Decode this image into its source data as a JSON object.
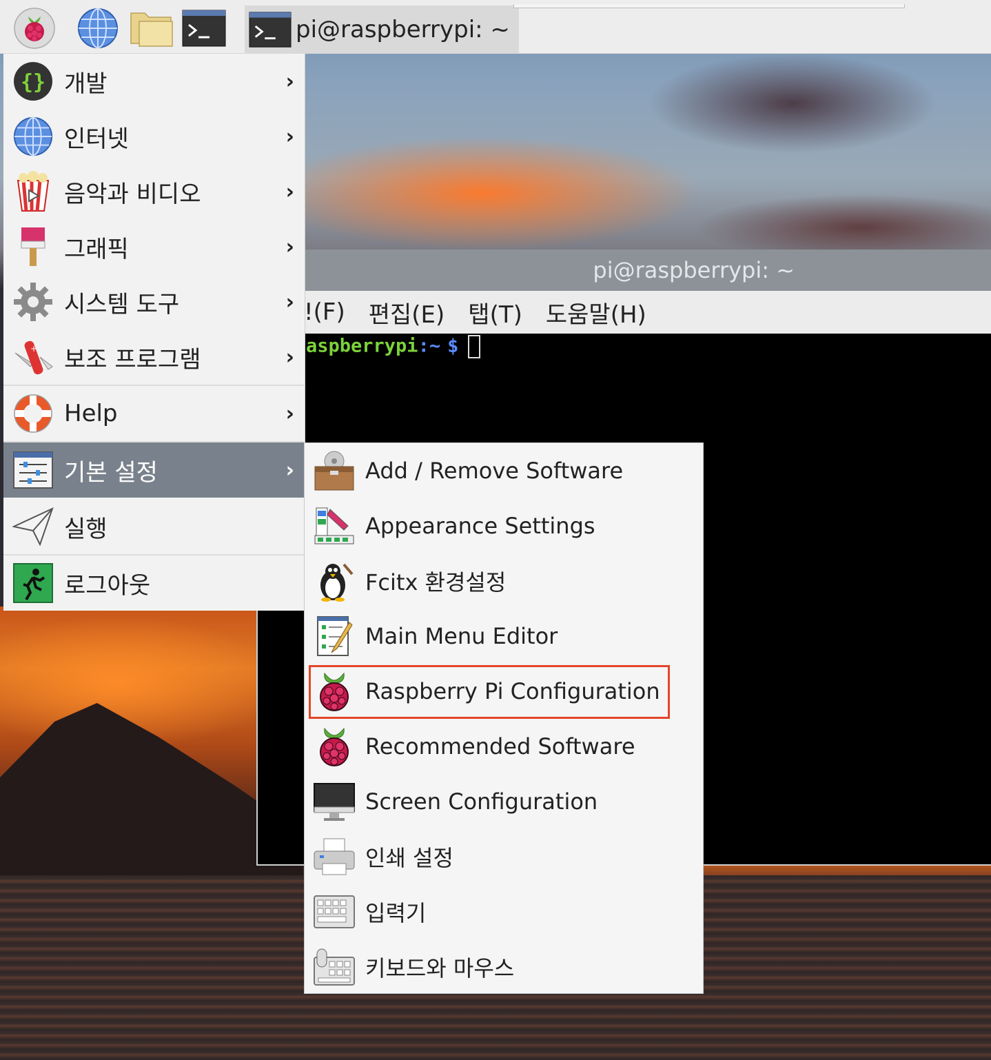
{
  "taskbar": {
    "launcher_icon": "raspberry-icon",
    "browser_icon": "globe-icon",
    "files_icon": "folder-icon",
    "terminal_icon": "terminal-icon",
    "task_title": "pi@raspberrypi: ~"
  },
  "terminal": {
    "title": "pi@raspberrypi: ~",
    "menu": [
      "!(F)",
      "편집(E)",
      "탭(T)",
      "도움말(H)"
    ],
    "prompt_host": "aspberrypi",
    "prompt_path": ":~",
    "prompt_symbol": "$"
  },
  "main_menu": {
    "items": [
      {
        "label": "개발",
        "icon": "code-braces-icon",
        "arrow": "›"
      },
      {
        "label": "인터넷",
        "icon": "globe-icon",
        "arrow": "›"
      },
      {
        "label": "음악과 비디오",
        "icon": "popcorn-video-icon",
        "arrow": "›"
      },
      {
        "label": "그래픽",
        "icon": "paintbrush-icon",
        "arrow": "›"
      },
      {
        "label": "시스템 도구",
        "icon": "gear-icon",
        "arrow": "›"
      },
      {
        "label": "보조 프로그램",
        "icon": "swiss-knife-icon",
        "arrow": "›"
      },
      {
        "label": "Help",
        "icon": "lifebuoy-icon",
        "arrow": "›"
      },
      {
        "label": "기본 설정",
        "icon": "preferences-sliders-icon",
        "arrow": "›",
        "active": true
      },
      {
        "label": "실행",
        "icon": "paper-plane-icon",
        "arrow": ""
      },
      {
        "label": "로그아웃",
        "icon": "exit-running-man-icon",
        "arrow": ""
      }
    ]
  },
  "sub_menu": {
    "items": [
      {
        "label": "Add / Remove Software",
        "icon": "package-box-icon"
      },
      {
        "label": "Appearance Settings",
        "icon": "color-palette-icon"
      },
      {
        "label": "Fcitx 환경설정",
        "icon": "penguin-icon"
      },
      {
        "label": "Main Menu Editor",
        "icon": "menu-editor-icon"
      },
      {
        "label": "Raspberry Pi Configuration",
        "icon": "raspberry-icon",
        "highlighted": true
      },
      {
        "label": "Recommended Software",
        "icon": "raspberry-icon"
      },
      {
        "label": "Screen Configuration",
        "icon": "monitor-icon"
      },
      {
        "label": "인쇄 설정",
        "icon": "printer-icon"
      },
      {
        "label": "입력기",
        "icon": "keyboard-icon"
      },
      {
        "label": "키보드와 마우스",
        "icon": "keyboard-mouse-icon"
      }
    ]
  },
  "colors": {
    "highlight_border": "#e4452a",
    "active_menu_bg": "#79828c",
    "prompt_green": "#7cd23a",
    "prompt_blue": "#5a8cff"
  }
}
